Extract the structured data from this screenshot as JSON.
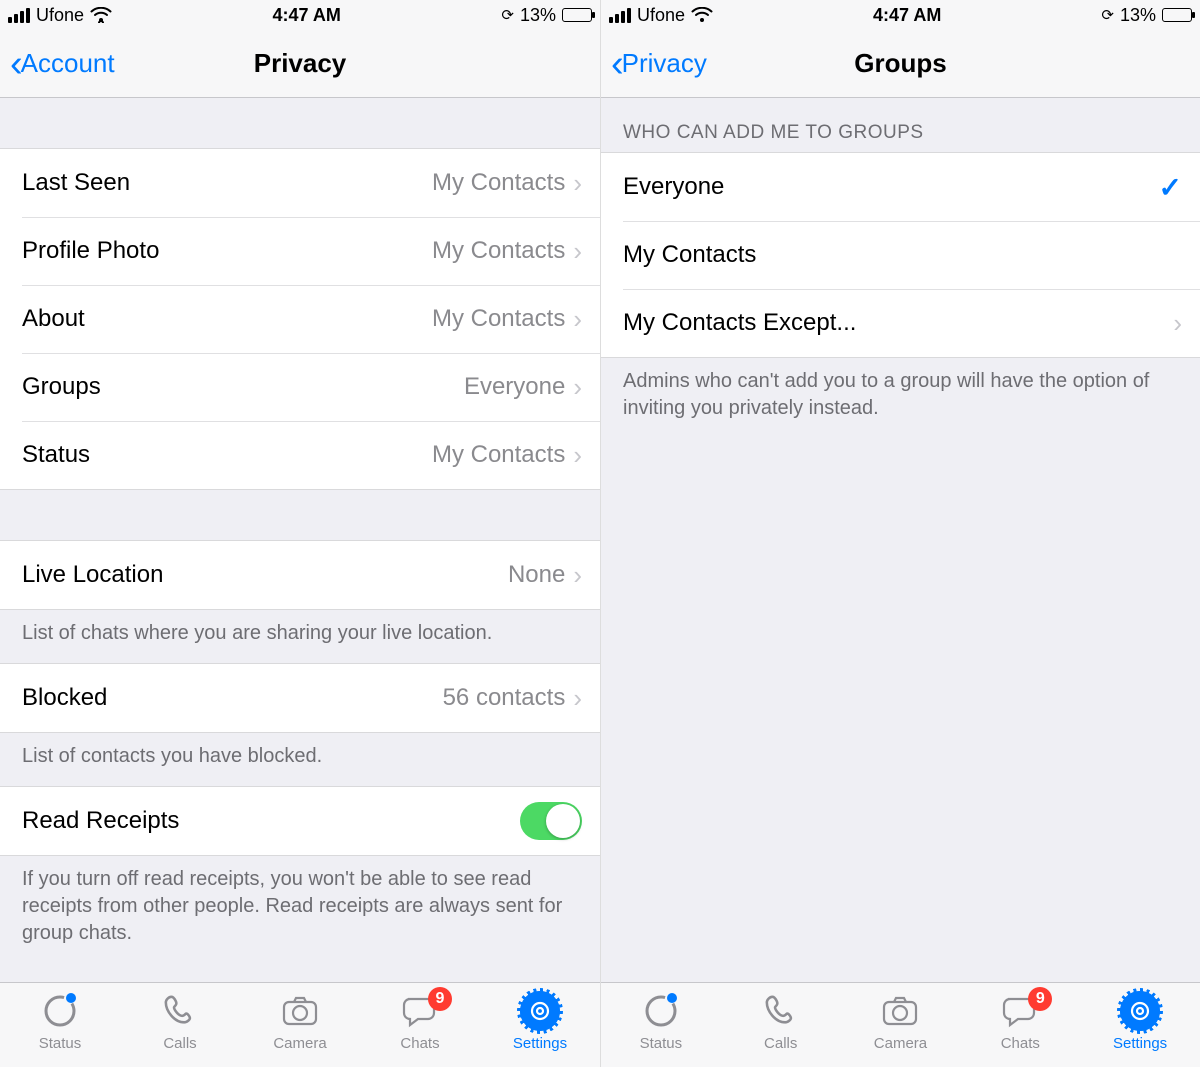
{
  "statusBar": {
    "carrier": "Ufone",
    "time": "4:47 AM",
    "batteryPercent": "13%"
  },
  "left": {
    "nav": {
      "back": "Account",
      "title": "Privacy"
    },
    "privacyRows": [
      {
        "label": "Last Seen",
        "value": "My Contacts"
      },
      {
        "label": "Profile Photo",
        "value": "My Contacts"
      },
      {
        "label": "About",
        "value": "My Contacts"
      },
      {
        "label": "Groups",
        "value": "Everyone"
      },
      {
        "label": "Status",
        "value": "My Contacts"
      }
    ],
    "liveLocation": {
      "label": "Live Location",
      "value": "None"
    },
    "liveLocationFooter": "List of chats where you are sharing your live location.",
    "blocked": {
      "label": "Blocked",
      "value": "56 contacts"
    },
    "blockedFooter": "List of contacts you have blocked.",
    "readReceipts": {
      "label": "Read Receipts"
    },
    "readReceiptsFooter": "If you turn off read receipts, you won't be able to see read receipts from other people. Read receipts are always sent for group chats."
  },
  "right": {
    "nav": {
      "back": "Privacy",
      "title": "Groups"
    },
    "sectionHeader": "WHO CAN ADD ME TO GROUPS",
    "options": [
      {
        "label": "Everyone",
        "selected": true
      },
      {
        "label": "My Contacts",
        "selected": false
      },
      {
        "label": "My Contacts Except...",
        "selected": false,
        "disclosure": true
      }
    ],
    "footer": "Admins who can't add you to a group will have the option of inviting you privately instead."
  },
  "tabs": {
    "items": [
      {
        "label": "Status"
      },
      {
        "label": "Calls"
      },
      {
        "label": "Camera"
      },
      {
        "label": "Chats",
        "badge": "9"
      },
      {
        "label": "Settings",
        "active": true
      }
    ]
  }
}
